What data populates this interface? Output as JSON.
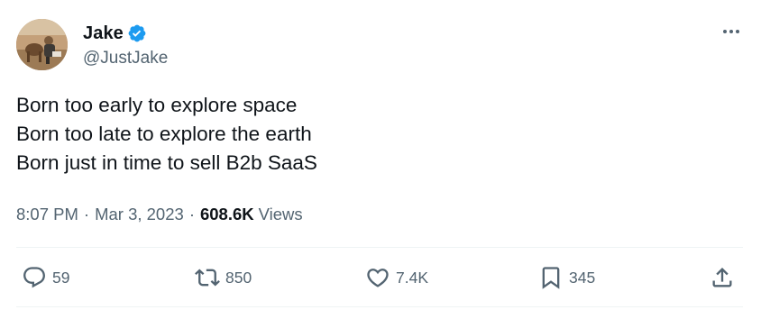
{
  "author": {
    "name": "Jake",
    "handle": "@JustJake",
    "verified": true,
    "verified_color": "#1d9bf0"
  },
  "tweet": {
    "lines": [
      "Born too early to explore space",
      "Born too late to explore the earth",
      "Born just in time to sell B2b SaaS"
    ],
    "time": "8:07 PM",
    "date": "Mar 3, 2023",
    "separator": "·",
    "views_count": "608.6K",
    "views_label": "Views"
  },
  "actions": {
    "reply": {
      "icon": "reply-icon",
      "count": "59"
    },
    "retweet": {
      "icon": "retweet-icon",
      "count": "850"
    },
    "like": {
      "icon": "heart-icon",
      "count": "7.4K"
    },
    "bookmark": {
      "icon": "bookmark-icon",
      "count": "345"
    },
    "share": {
      "icon": "share-icon"
    }
  },
  "colors": {
    "text_primary": "#0f1419",
    "text_secondary": "#536471",
    "divider": "#eff3f4"
  }
}
